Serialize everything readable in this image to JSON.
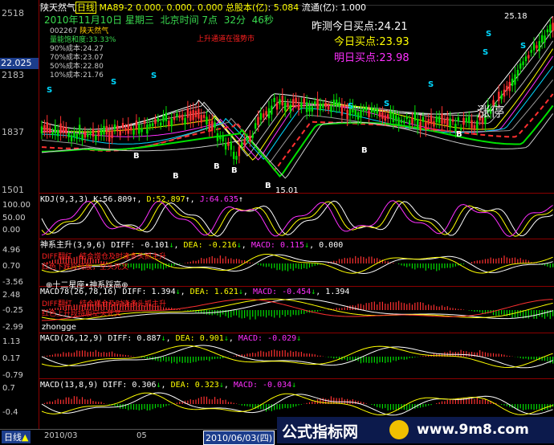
{
  "stock": {
    "name": "陕天然气",
    "label": "日线",
    "date": "2010年11月10日",
    "weekday": "星期三",
    "time_label": "北京时间",
    "time_hour": "7点",
    "time_min": "32分",
    "time_sec": "46秒",
    "ma_label": "MA89-2",
    "ma_values": "0.000, 0.000, 0.000",
    "total_cap_label": "总股本(亿)",
    "total_cap": "5.084",
    "float_label": "流通(亿)",
    "float_cap": "1.000"
  },
  "price_axis": {
    "ticks": [
      "2518",
      "2183",
      "1837",
      "1501"
    ],
    "current_price": "22.025",
    "high_label": "25.18",
    "low_label": "15.01"
  },
  "forecast": {
    "yesterday_label": "昨测今日买点:",
    "yesterday_value": "24.21",
    "today_label": "今日买点:",
    "today_value": "23.93",
    "tomorrow_label": "明日买点:",
    "tomorrow_value": "23.98"
  },
  "legend": {
    "code": "002267",
    "code_note": "陕天然气",
    "saturation_label": "量能饱和度",
    "saturation": "33.33%",
    "c90_label": "90%成本",
    "c90": "24.27",
    "c70_label": "70%成本",
    "c70": "23.07",
    "c50_label": "50%成本",
    "c50": "22.80",
    "c10_label": "10%成本",
    "c10": "21.76",
    "red_note": "上升通道在强势市"
  },
  "labels": {
    "limit_up": "涨停",
    "s": "S",
    "b": "B"
  },
  "kdj": {
    "title": "KDJ(9,3,3)",
    "k_label": "K:",
    "k": "56.809",
    "d_label": "D:",
    "d": "52.897",
    "j_label": "J:",
    "j": "64.635",
    "ticks": [
      "100.00",
      "50.00",
      "0.00"
    ]
  },
  "shen": {
    "title": "神系主升(3,9,6)",
    "diff": "DIFF: -0.101",
    "dea": "DEA: -0.216",
    "macd": "MACD: 0.115",
    "extra": "0.000",
    "note1": "DIFF翻红，结合增仓及时逢多头抓主升",
    "note2": "红色下跌段持股，空头死叉",
    "star": "⊕十二星座•神系踩高⊕",
    "ticks": [
      "4.96",
      "0.70",
      "-3.56"
    ]
  },
  "macd78": {
    "title": "MACD78(26,78,16)",
    "diff": "DIFF: 1.394",
    "dea": "DEA: 1.621",
    "macd": "MACD: -0.454",
    "extra": "1.394",
    "note1": "DIFF翻红，结合增仓及时逢多头抓主升",
    "note2": "红色上升段持股空头死叉",
    "author": "zhongge",
    "ticks": [
      "2.48",
      "-0.25",
      "-2.99"
    ]
  },
  "macd1": {
    "title": "MACD(26,12,9)",
    "diff": "DIFF: 0.887",
    "dea": "DEA: 0.901",
    "macd": "MACD: -0.029",
    "ticks": [
      "1.13",
      "0.17",
      "-0.79"
    ]
  },
  "macd2": {
    "title": "MACD(13,8,9)",
    "diff": "DIFF: 0.306",
    "dea": "DEA: 0.323",
    "macd": "MACD: -0.034",
    "ticks": [
      "0.7",
      "-0.4"
    ]
  },
  "bottom": {
    "period": "日线",
    "dates": [
      "2010/03",
      "05"
    ],
    "cursor_date": "2010/06/03(四)",
    "watermark_cn": "公式指标网",
    "watermark_url": "www.9m8.com"
  },
  "colors": {
    "bg": "#000000",
    "grid": "#8b0000",
    "up": "#ff3030",
    "down": "#00e000",
    "white": "#ffffff",
    "yellow": "#ffff00",
    "magenta": "#ff30ff",
    "cyan": "#00d8ff"
  }
}
